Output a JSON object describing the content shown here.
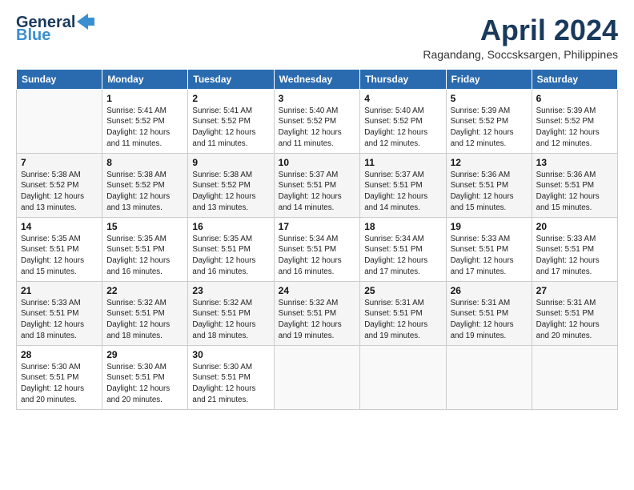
{
  "header": {
    "logo_general": "General",
    "logo_blue": "Blue",
    "month_title": "April 2024",
    "location": "Ragandang, Soccsksargen, Philippines"
  },
  "weekdays": [
    "Sunday",
    "Monday",
    "Tuesday",
    "Wednesday",
    "Thursday",
    "Friday",
    "Saturday"
  ],
  "weeks": [
    [
      {
        "day": "",
        "sunrise": "",
        "sunset": "",
        "daylight": ""
      },
      {
        "day": "1",
        "sunrise": "Sunrise: 5:41 AM",
        "sunset": "Sunset: 5:52 PM",
        "daylight": "Daylight: 12 hours and 11 minutes."
      },
      {
        "day": "2",
        "sunrise": "Sunrise: 5:41 AM",
        "sunset": "Sunset: 5:52 PM",
        "daylight": "Daylight: 12 hours and 11 minutes."
      },
      {
        "day": "3",
        "sunrise": "Sunrise: 5:40 AM",
        "sunset": "Sunset: 5:52 PM",
        "daylight": "Daylight: 12 hours and 11 minutes."
      },
      {
        "day": "4",
        "sunrise": "Sunrise: 5:40 AM",
        "sunset": "Sunset: 5:52 PM",
        "daylight": "Daylight: 12 hours and 12 minutes."
      },
      {
        "day": "5",
        "sunrise": "Sunrise: 5:39 AM",
        "sunset": "Sunset: 5:52 PM",
        "daylight": "Daylight: 12 hours and 12 minutes."
      },
      {
        "day": "6",
        "sunrise": "Sunrise: 5:39 AM",
        "sunset": "Sunset: 5:52 PM",
        "daylight": "Daylight: 12 hours and 12 minutes."
      }
    ],
    [
      {
        "day": "7",
        "sunrise": "Sunrise: 5:38 AM",
        "sunset": "Sunset: 5:52 PM",
        "daylight": "Daylight: 12 hours and 13 minutes."
      },
      {
        "day": "8",
        "sunrise": "Sunrise: 5:38 AM",
        "sunset": "Sunset: 5:52 PM",
        "daylight": "Daylight: 12 hours and 13 minutes."
      },
      {
        "day": "9",
        "sunrise": "Sunrise: 5:38 AM",
        "sunset": "Sunset: 5:52 PM",
        "daylight": "Daylight: 12 hours and 13 minutes."
      },
      {
        "day": "10",
        "sunrise": "Sunrise: 5:37 AM",
        "sunset": "Sunset: 5:51 PM",
        "daylight": "Daylight: 12 hours and 14 minutes."
      },
      {
        "day": "11",
        "sunrise": "Sunrise: 5:37 AM",
        "sunset": "Sunset: 5:51 PM",
        "daylight": "Daylight: 12 hours and 14 minutes."
      },
      {
        "day": "12",
        "sunrise": "Sunrise: 5:36 AM",
        "sunset": "Sunset: 5:51 PM",
        "daylight": "Daylight: 12 hours and 15 minutes."
      },
      {
        "day": "13",
        "sunrise": "Sunrise: 5:36 AM",
        "sunset": "Sunset: 5:51 PM",
        "daylight": "Daylight: 12 hours and 15 minutes."
      }
    ],
    [
      {
        "day": "14",
        "sunrise": "Sunrise: 5:35 AM",
        "sunset": "Sunset: 5:51 PM",
        "daylight": "Daylight: 12 hours and 15 minutes."
      },
      {
        "day": "15",
        "sunrise": "Sunrise: 5:35 AM",
        "sunset": "Sunset: 5:51 PM",
        "daylight": "Daylight: 12 hours and 16 minutes."
      },
      {
        "day": "16",
        "sunrise": "Sunrise: 5:35 AM",
        "sunset": "Sunset: 5:51 PM",
        "daylight": "Daylight: 12 hours and 16 minutes."
      },
      {
        "day": "17",
        "sunrise": "Sunrise: 5:34 AM",
        "sunset": "Sunset: 5:51 PM",
        "daylight": "Daylight: 12 hours and 16 minutes."
      },
      {
        "day": "18",
        "sunrise": "Sunrise: 5:34 AM",
        "sunset": "Sunset: 5:51 PM",
        "daylight": "Daylight: 12 hours and 17 minutes."
      },
      {
        "day": "19",
        "sunrise": "Sunrise: 5:33 AM",
        "sunset": "Sunset: 5:51 PM",
        "daylight": "Daylight: 12 hours and 17 minutes."
      },
      {
        "day": "20",
        "sunrise": "Sunrise: 5:33 AM",
        "sunset": "Sunset: 5:51 PM",
        "daylight": "Daylight: 12 hours and 17 minutes."
      }
    ],
    [
      {
        "day": "21",
        "sunrise": "Sunrise: 5:33 AM",
        "sunset": "Sunset: 5:51 PM",
        "daylight": "Daylight: 12 hours and 18 minutes."
      },
      {
        "day": "22",
        "sunrise": "Sunrise: 5:32 AM",
        "sunset": "Sunset: 5:51 PM",
        "daylight": "Daylight: 12 hours and 18 minutes."
      },
      {
        "day": "23",
        "sunrise": "Sunrise: 5:32 AM",
        "sunset": "Sunset: 5:51 PM",
        "daylight": "Daylight: 12 hours and 18 minutes."
      },
      {
        "day": "24",
        "sunrise": "Sunrise: 5:32 AM",
        "sunset": "Sunset: 5:51 PM",
        "daylight": "Daylight: 12 hours and 19 minutes."
      },
      {
        "day": "25",
        "sunrise": "Sunrise: 5:31 AM",
        "sunset": "Sunset: 5:51 PM",
        "daylight": "Daylight: 12 hours and 19 minutes."
      },
      {
        "day": "26",
        "sunrise": "Sunrise: 5:31 AM",
        "sunset": "Sunset: 5:51 PM",
        "daylight": "Daylight: 12 hours and 19 minutes."
      },
      {
        "day": "27",
        "sunrise": "Sunrise: 5:31 AM",
        "sunset": "Sunset: 5:51 PM",
        "daylight": "Daylight: 12 hours and 20 minutes."
      }
    ],
    [
      {
        "day": "28",
        "sunrise": "Sunrise: 5:30 AM",
        "sunset": "Sunset: 5:51 PM",
        "daylight": "Daylight: 12 hours and 20 minutes."
      },
      {
        "day": "29",
        "sunrise": "Sunrise: 5:30 AM",
        "sunset": "Sunset: 5:51 PM",
        "daylight": "Daylight: 12 hours and 20 minutes."
      },
      {
        "day": "30",
        "sunrise": "Sunrise: 5:30 AM",
        "sunset": "Sunset: 5:51 PM",
        "daylight": "Daylight: 12 hours and 21 minutes."
      },
      {
        "day": "",
        "sunrise": "",
        "sunset": "",
        "daylight": ""
      },
      {
        "day": "",
        "sunrise": "",
        "sunset": "",
        "daylight": ""
      },
      {
        "day": "",
        "sunrise": "",
        "sunset": "",
        "daylight": ""
      },
      {
        "day": "",
        "sunrise": "",
        "sunset": "",
        "daylight": ""
      }
    ]
  ]
}
